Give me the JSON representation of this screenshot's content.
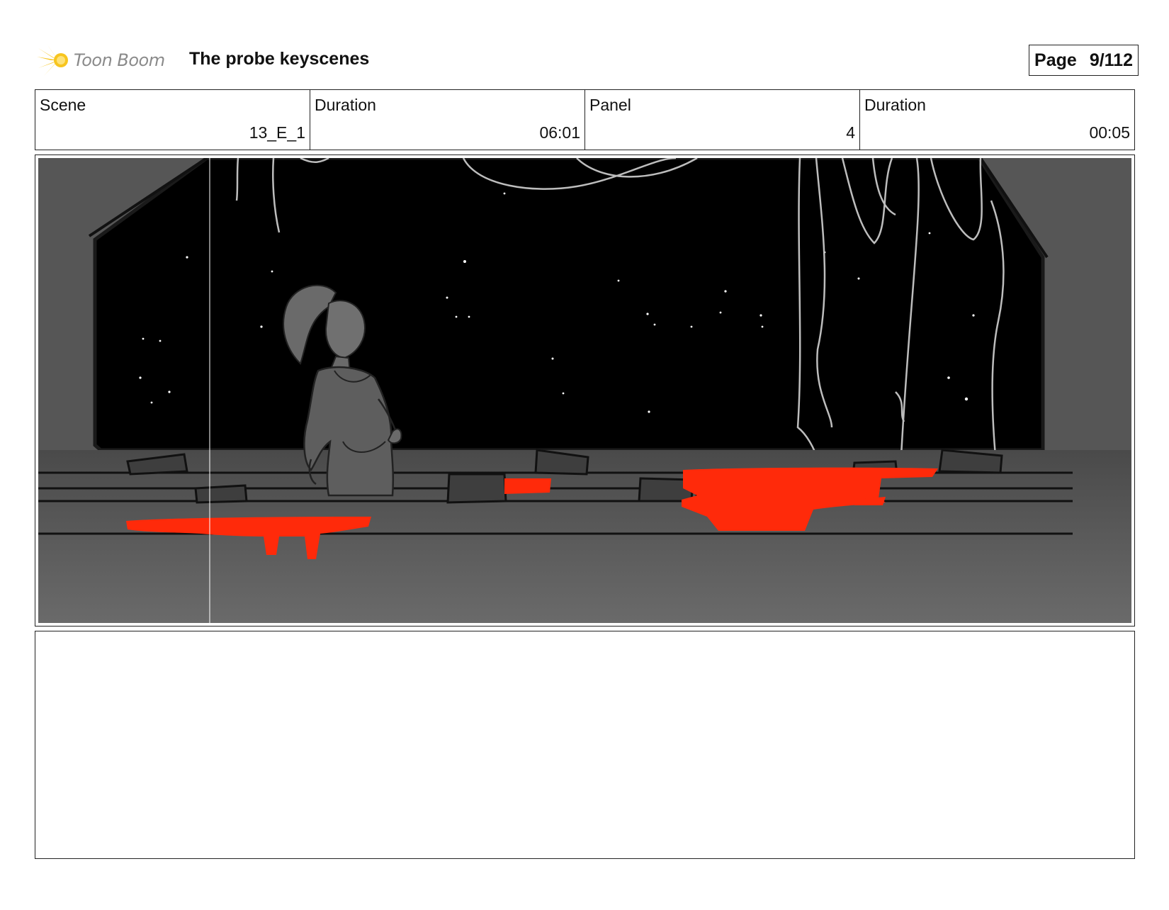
{
  "header": {
    "logo_text": "Toon Boom",
    "project_title": "The probe keyscenes",
    "page_label": "Page",
    "page_number": "9/112"
  },
  "info": {
    "scene_label": "Scene",
    "scene_value": "13_E_1",
    "scene_duration_label": "Duration",
    "scene_duration_value": "06:01",
    "panel_label": "Panel",
    "panel_value": "4",
    "panel_duration_label": "Duration",
    "panel_duration_value": "00:05"
  },
  "colors": {
    "accent_red": "#ff2a0a",
    "logo_yellow": "#f7c51e",
    "sky": "#000000",
    "wall_gray": "#555555"
  }
}
